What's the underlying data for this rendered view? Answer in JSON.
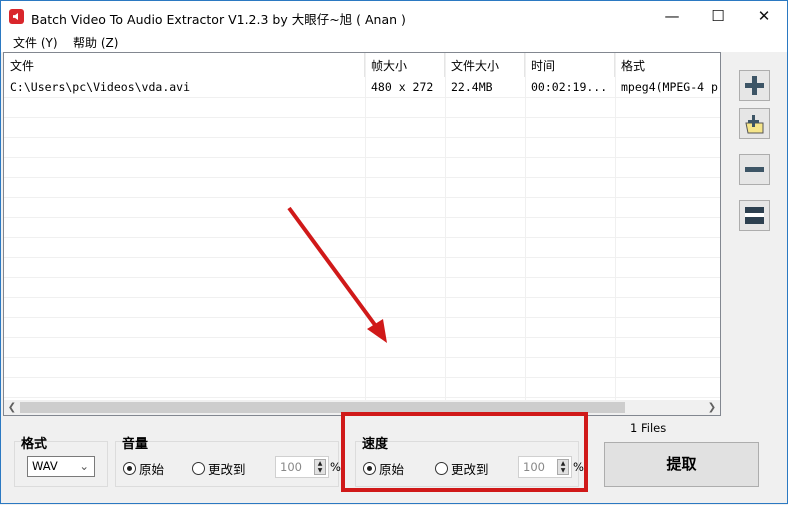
{
  "window": {
    "title": "Batch Video To Audio Extractor V1.2.3 by 大眼仔~旭 ( Anan )",
    "minimize": "—",
    "maximize": "☐",
    "close": "✕"
  },
  "menu": [
    "文件 (Y)",
    "帮助 (Z)"
  ],
  "table": {
    "columns": [
      "文件",
      "帧大小",
      "文件大小",
      "时间",
      "格式"
    ],
    "rows": [
      [
        "C:\\Users\\pc\\Videos\\vda.avi",
        "480 x 272",
        "22.4MB",
        "00:02:19...",
        "mpeg4(MPEG-4 p"
      ]
    ]
  },
  "sidebar": {
    "add_file": "add-file",
    "add_folder": "add-folder",
    "remove": "remove",
    "clear": "clear"
  },
  "format": {
    "label": "格式",
    "value": "WAV"
  },
  "volume": {
    "label": "音量",
    "original": "原始",
    "change": "更改到",
    "value": "100",
    "unit": "%",
    "selected": "original"
  },
  "speed": {
    "label": "速度",
    "original": "原始",
    "change": "更改到",
    "value": "100",
    "unit": "%",
    "selected": "original"
  },
  "status": {
    "files": "1 Files"
  },
  "extract_label": "提取",
  "accent": "#d01919"
}
